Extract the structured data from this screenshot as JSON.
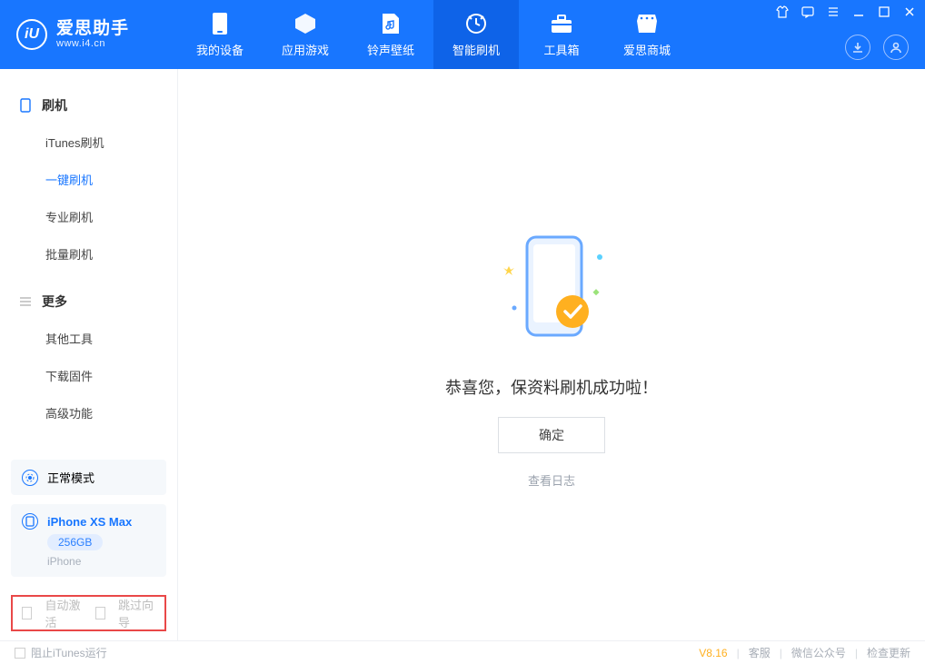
{
  "logo": {
    "title": "爱思助手",
    "subtitle": "www.i4.cn",
    "mark": "iU"
  },
  "tabs": [
    {
      "label": "我的设备"
    },
    {
      "label": "应用游戏"
    },
    {
      "label": "铃声壁纸"
    },
    {
      "label": "智能刷机"
    },
    {
      "label": "工具箱"
    },
    {
      "label": "爱思商城"
    }
  ],
  "sidebar": {
    "group1": {
      "title": "刷机",
      "items": [
        "iTunes刷机",
        "一键刷机",
        "专业刷机",
        "批量刷机"
      ]
    },
    "group2": {
      "title": "更多",
      "items": [
        "其他工具",
        "下载固件",
        "高级功能"
      ]
    }
  },
  "device_mode": {
    "label": "正常模式"
  },
  "device": {
    "name": "iPhone XS Max",
    "capacity": "256GB",
    "type": "iPhone"
  },
  "bottom_options": {
    "opt1": "自动激活",
    "opt2": "跳过向导"
  },
  "result": {
    "message": "恭喜您，保资料刷机成功啦！",
    "ok": "确定",
    "log": "查看日志"
  },
  "footer": {
    "block_itunes": "阻止iTunes运行",
    "version": "V8.16",
    "links": [
      "客服",
      "微信公众号",
      "检查更新"
    ]
  }
}
